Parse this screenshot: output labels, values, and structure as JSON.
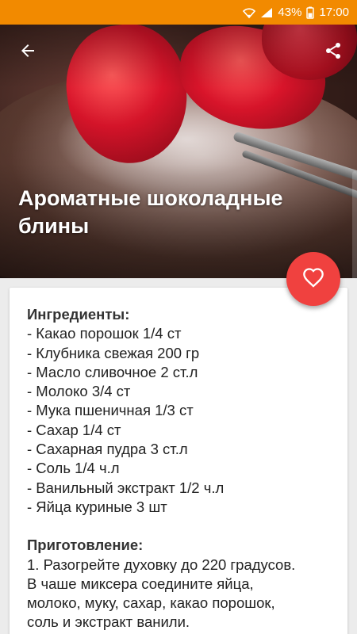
{
  "status_bar": {
    "battery_percent": "43%",
    "time": "17:00",
    "icons": [
      "wifi-icon",
      "signal-icon",
      "battery-icon"
    ],
    "color": "#f28a00"
  },
  "toolbar": {
    "back_icon": "arrow-back-icon",
    "share_icon": "share-icon"
  },
  "recipe": {
    "title": "Ароматные шоколадные блины",
    "favorite_icon": "heart-outline-icon",
    "accent_color": "#f0413f",
    "ingredients_heading": "Ингредиенты:",
    "ingredients": [
      "- Какао порошок 1/4 ст",
      "- Клубника свежая 200 гр",
      "- Масло сливочное 2 ст.л",
      "- Молоко 3/4 ст",
      "- Мука пшеничная 1/3 ст",
      "- Сахар 1/4 ст",
      "- Сахарная пудра 3 ст.л",
      "- Соль 1/4 ч.л",
      "- Ванильный экстракт 1/2 ч.л",
      "- Яйца куриные 3 шт"
    ],
    "preparation_heading": "Приготовление:",
    "preparation_lines": [
      "1. Разогрейте духовку до 220 градусов.",
      "В чаше миксера соедините яйца,",
      "молоко, муку, сахар, какао порошок,",
      "соль и экстракт ванили."
    ]
  }
}
